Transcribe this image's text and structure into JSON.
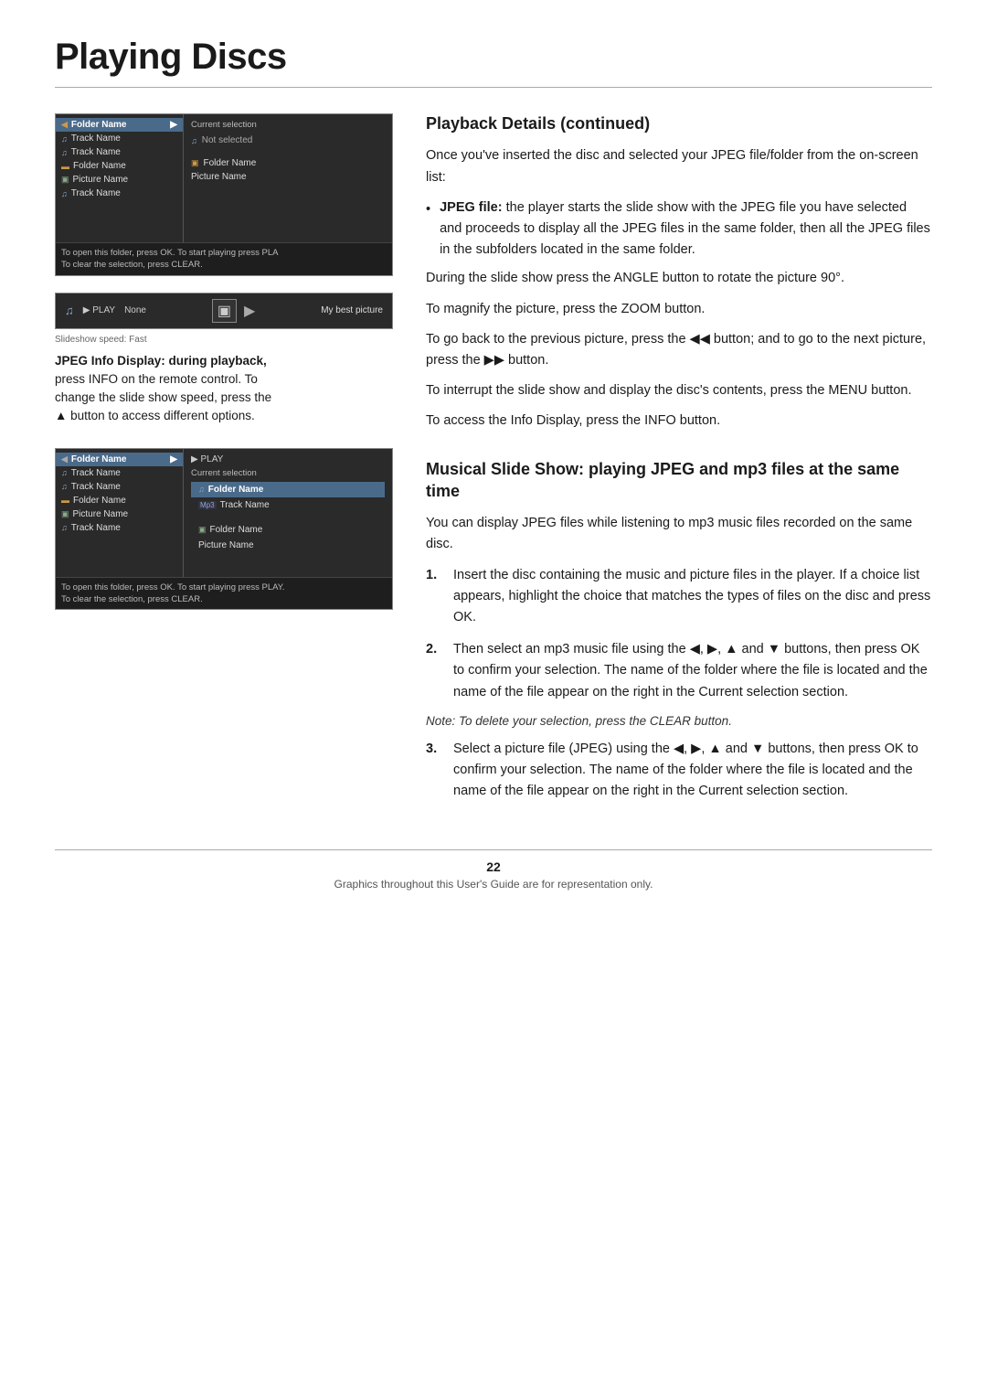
{
  "page": {
    "title": "Playing Discs",
    "footer_page": "22",
    "footer_note": "Graphics throughout this User's Guide are for representation only."
  },
  "screen1": {
    "folder_header": "Folder Name",
    "items": [
      {
        "type": "music",
        "label": "Track Name"
      },
      {
        "type": "music",
        "label": "Track Name"
      },
      {
        "type": "folder",
        "label": "Folder Name"
      },
      {
        "type": "picture",
        "label": "Picture Name"
      },
      {
        "type": "music",
        "label": "Track Name"
      }
    ],
    "current_selection_label": "Current selection",
    "right_items": [
      {
        "type": "music",
        "label": "Not selected"
      },
      {
        "type": "folder",
        "label": "Folder Name"
      },
      {
        "type": "text",
        "label": "Picture Name"
      }
    ],
    "bottom_text1": "To open this folder, press OK. To start playing press PLA",
    "bottom_text2": "To clear the selection, press CLEAR."
  },
  "screen_jpeg": {
    "play_label": "▶ PLAY",
    "play_value": "None",
    "speed_label": "Slideshow speed: Fast",
    "right_label": "My best picture"
  },
  "jpeg_caption": {
    "line1": "JPEG Info Display: during playback,",
    "line2": "press INFO on the remote control. To",
    "line3": "change the slide show speed, press the",
    "line4": "▲  button to access different options."
  },
  "playback_section": {
    "heading": "Playback Details (continued)",
    "intro": "Once you've inserted the disc and selected your JPEG file/folder from the on-screen list:",
    "bullet_label": "JPEG file:",
    "bullet_text": "the player starts the slide show with the JPEG file you have selected and proceeds to display all the JPEG files in the same folder, then all the JPEG files in the subfolders located in the same folder.",
    "para1": "During the slide show press the ANGLE button to rotate the picture 90°.",
    "para2": "To magnify the picture, press the ZOOM button.",
    "para3": "To go back to the previous picture, press the ◀◀  button; and to go to the next picture, press the ▶▶  button.",
    "para4": "To interrupt the slide show and display the disc's contents, press the MENU button.",
    "para5": "To access the Info Display, press the INFO button."
  },
  "screen2": {
    "folder_header": "Folder Name",
    "items": [
      {
        "type": "music",
        "label": "Track Name"
      },
      {
        "type": "music",
        "label": "Track Name"
      },
      {
        "type": "folder",
        "label": "Folder Name"
      },
      {
        "type": "picture",
        "label": "Picture Name"
      },
      {
        "type": "music",
        "label": "Track Name"
      }
    ],
    "play_label": "▶ PLAY",
    "current_selection_label": "Current selection",
    "right_folder": "Folder Name",
    "right_track": "Track Name",
    "right_folder2": "Folder Name",
    "right_picture": "Picture Name",
    "bottom_text1": "To open this folder, press OK. To start playing press PLAY.",
    "bottom_text2": "To clear the selection, press CLEAR."
  },
  "musical_section": {
    "heading": "Musical Slide Show: playing JPEG and mp3 files at the same time",
    "intro": "You can display JPEG files while listening to mp3 music files recorded on the same disc.",
    "step1_num": "1.",
    "step1": "Insert the disc containing the music and picture files in the player. If a choice list appears,  highlight the choice that matches the types of files on the disc and press OK.",
    "step2_num": "2.",
    "step2": "Then select an mp3 music file using the ◀, ▶, ▲ and ▼ buttons, then press OK to confirm your selection. The name of the folder where the file is located and the name of the file appear on the right in the Current selection section.",
    "note": "Note: To delete your selection, press the CLEAR button.",
    "step3_num": "3.",
    "step3": "Select a picture file (JPEG) using the ◀, ▶, ▲ and ▼ buttons, then press OK to confirm your selection. The name of the folder where the file is located and the name of the file appear on the right in the Current selection section."
  }
}
